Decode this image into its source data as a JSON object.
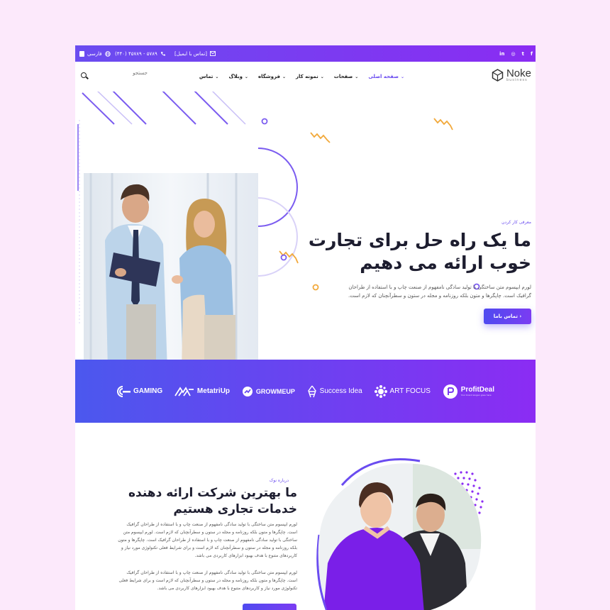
{
  "topbar": {
    "language": "فارسی",
    "phone": "(۴۴۰) ۴۵۷۸۹ - ۵۷۸۹",
    "email_link": "[تماس با ایمیل]",
    "social_icons": [
      "facebook-icon",
      "twitter-icon",
      "instagram-icon",
      "linkedin-icon"
    ]
  },
  "nav": {
    "search_placeholder": "جستجو",
    "logo_main": "Noke",
    "logo_sub": "business",
    "menu": [
      {
        "label": "صفحه اصلی",
        "active": true
      },
      {
        "label": "صفحات",
        "active": false
      },
      {
        "label": "نمونه کار",
        "active": false
      },
      {
        "label": "فروشگاه",
        "active": false
      },
      {
        "label": "وبلاگ",
        "active": false
      },
      {
        "label": "تماس",
        "active": false
      }
    ]
  },
  "hero": {
    "eyebrow": "معرفی کار کردن",
    "title": "ما یک راه حل برای تجارت خوب ارائه می دهیم",
    "text": "لورم ایپسوم متن ساختگی با تولید سادگی نامفهوم از صنعت چاپ و با استفاده از طراحان گرافیک است. چاپگرها و متون بلکه روزنامه و مجله در ستون و سطرآنچنان که لازم است.",
    "button": "تماس باما ›"
  },
  "brands": [
    "ProfitDeal",
    "ART FOCUS",
    "Success Idea",
    "GROWMEUP",
    "MetatriUp",
    "GAMING"
  ],
  "brand_tagline": "Your brand slogan goes here",
  "about": {
    "eyebrow": "درباره نوک",
    "title": "ما بهترین شرکت ارائه دهنده خدمات تجاری هستیم",
    "p1": "لورم ایپسوم متن ساختگی با تولید سادگی نامفهوم از صنعت چاپ و با استفاده از طراحان گرافیک است. چاپگرها و متون بلکه روزنامه و مجله در ستون و سطرآنچنان که لازم است. لورم ایپسوم متن ساختگی با تولید سادگی نامفهوم از صنعت چاپ و با استفاده از طراحان گرافیک است. چاپگرها و متون بلکه روزنامه و مجله در ستون و سطرآنچنان که لازم است و برای شرایط فعلی تکنولوژی مورد نیاز و کاربردهای متنوع با هدف بهبود ابزارهای کاربردی می باشد.",
    "p2": "لورم ایپسوم متن ساختگی با تولید سادگی نامفهوم از صنعت چاپ و با استفاده از طراحان گرافیک است. چاپگرها و متون بلکه روزنامه و مجله در ستون و سطرآنچنان که لازم است و برای شرایط فعلی تکنولوژی مورد نیاز و کاربردهای متنوع با هدف بهبود ابزارهای کاربردی می باشد."
  },
  "colors": {
    "accent": "#6a4cf0",
    "gradient_start": "#4b58ee",
    "gradient_end": "#8b2cf3",
    "page_bg": "#fce9fb",
    "orange": "#f2a93b"
  }
}
